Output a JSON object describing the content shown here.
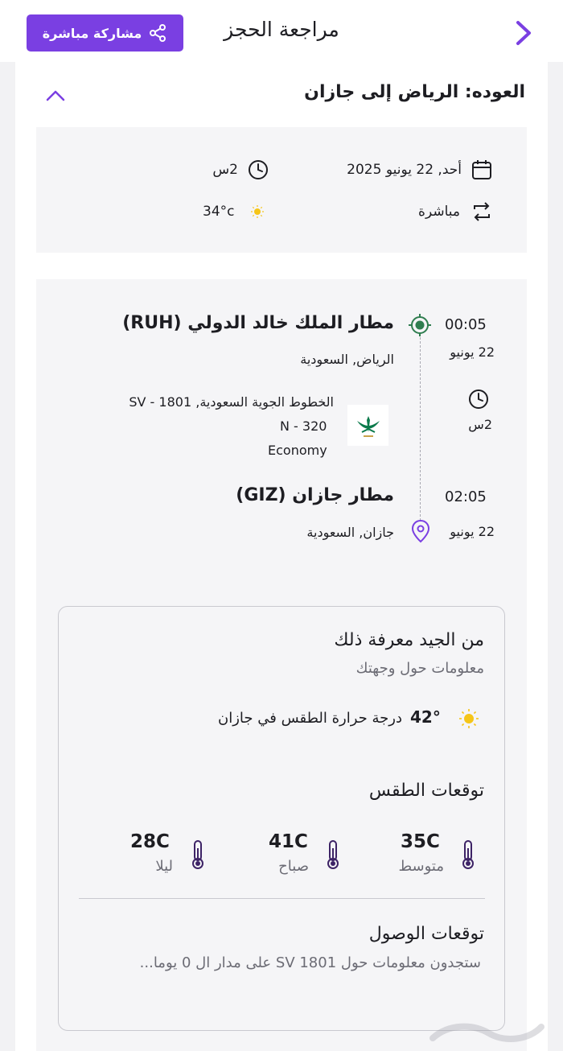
{
  "header": {
    "title": "مراجعة الحجز",
    "share_label": "مشاركة مباشرة"
  },
  "section": {
    "title": "العوده: الرياض إلى جازان"
  },
  "summary": {
    "date": "أحد, 22 يونيو 2025",
    "duration": "2س",
    "stops": "مباشرة",
    "temperature": "34°c"
  },
  "flight": {
    "departure": {
      "time": "00:05",
      "date": "22 يونيو",
      "airport": "مطار الملك خالد الدولي (RUH)",
      "city": "الرياض, السعودية"
    },
    "duration": "2س",
    "airline": "الخطوط الجوية السعودية, 1801 - SV",
    "aircraft": "N - 320",
    "cabin": "Economy",
    "arrival": {
      "time": "02:05",
      "date": "22 يونيو",
      "airport": "مطار جازان  (GIZ)",
      "city": "جازان, السعودية"
    }
  },
  "good_to_know": {
    "title": "من الجيد معرفة ذلك",
    "subtitle": "معلومات حول وجهتك",
    "weather_value": "42°",
    "weather_text": "درجة حرارة الطقس في جازان",
    "forecast_title": "توقعات الطقس",
    "forecast": [
      {
        "value": "35C",
        "label": "متوسط"
      },
      {
        "value": "41C",
        "label": "صباح"
      },
      {
        "value": "28C",
        "label": "ليلا"
      }
    ],
    "arrival_title": "توقعات الوصول",
    "arrival_text": "ستجدون معلومات حول SV 1801 على مدار ال 0 يوما..."
  },
  "colors": {
    "accent": "#7a3fe2",
    "departure_marker": "#2f7d4f",
    "arrival_marker": "#7a3fe2",
    "sun": "#f5c518"
  }
}
